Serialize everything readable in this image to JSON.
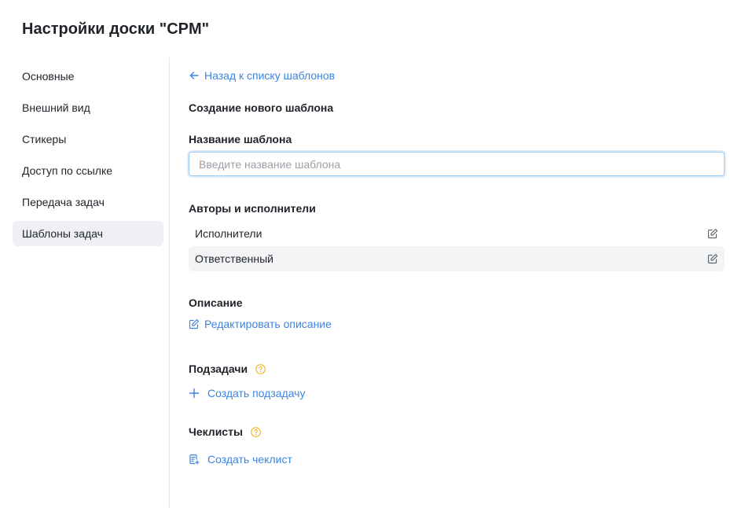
{
  "page": {
    "title": "Настройки доски \"CPM\""
  },
  "sidebar": {
    "items": [
      {
        "label": "Основные",
        "active": false
      },
      {
        "label": "Внешний вид",
        "active": false
      },
      {
        "label": "Стикеры",
        "active": false
      },
      {
        "label": "Доступ по ссылке",
        "active": false
      },
      {
        "label": "Передача задач",
        "active": false
      },
      {
        "label": "Шаблоны задач",
        "active": true
      }
    ]
  },
  "content": {
    "back_link": "Назад к списку шаблонов",
    "heading": "Создание нового шаблона",
    "name_section": {
      "label": "Название шаблона",
      "input_value": "",
      "placeholder": "Введите название шаблона"
    },
    "roles_section": {
      "label": "Авторы и исполнители",
      "rows": [
        {
          "label": "Исполнители"
        },
        {
          "label": "Ответственный"
        }
      ]
    },
    "description_section": {
      "label": "Описание",
      "edit_link": "Редактировать описание"
    },
    "subtasks_section": {
      "label": "Подзадачи",
      "create_link": "Создать подзадачу"
    },
    "checklists_section": {
      "label": "Чеклисты",
      "create_link": "Создать чеклист"
    }
  },
  "icons": {
    "back": "arrow-left-icon",
    "edit": "pencil-square-icon",
    "help": "question-circle-icon",
    "add": "plus-icon",
    "checklist": "checklist-add-icon"
  },
  "colors": {
    "accent": "#3d84e0",
    "help": "#f0b429",
    "active_bg": "#eef0f3",
    "input_focus_border": "#9ccbf3"
  }
}
